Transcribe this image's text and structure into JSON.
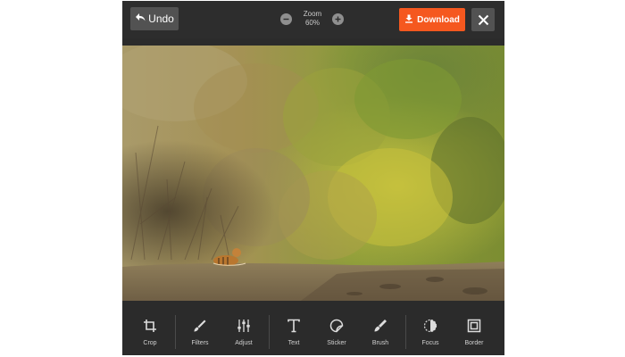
{
  "topbar": {
    "undo_label": "Undo",
    "zoom_label": "Zoom",
    "zoom_value": "60%",
    "download_label": "Download",
    "accent_color": "#f5581f"
  },
  "toolbar": {
    "tools": [
      {
        "label": "Crop",
        "icon": "crop-icon"
      },
      {
        "label": "Filters",
        "icon": "filters-icon"
      },
      {
        "label": "Adjust",
        "icon": "adjust-icon"
      },
      {
        "label": "Text",
        "icon": "text-icon"
      },
      {
        "label": "Sticker",
        "icon": "sticker-icon"
      },
      {
        "label": "Brush",
        "icon": "brush-icon"
      },
      {
        "label": "Focus",
        "icon": "focus-icon"
      },
      {
        "label": "Border",
        "icon": "border-icon"
      }
    ]
  }
}
